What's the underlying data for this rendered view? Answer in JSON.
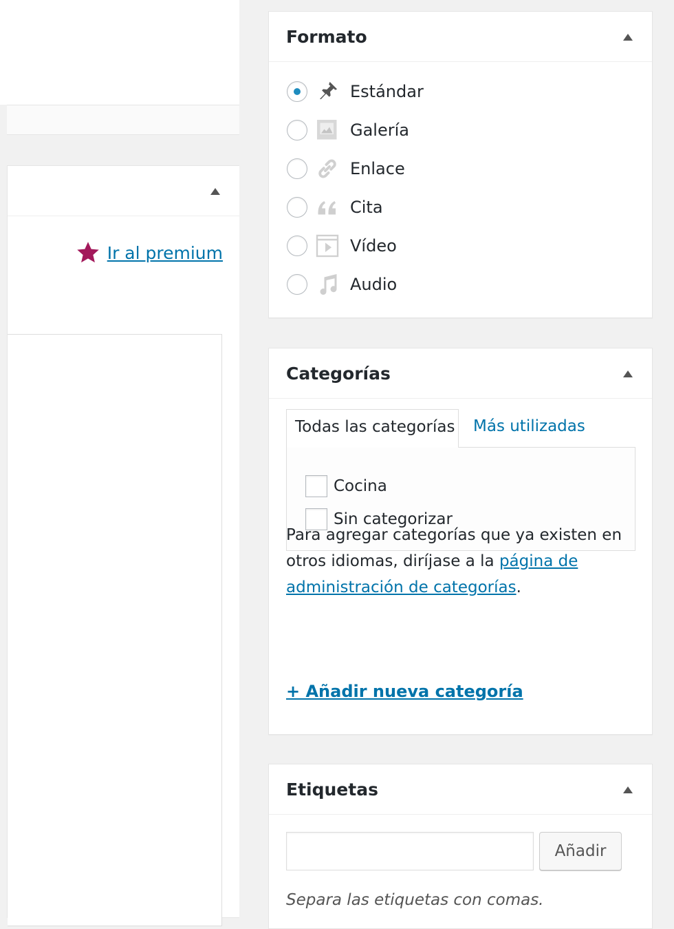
{
  "left": {
    "premium_link": "Ir al premium",
    "star_color": "#a3195b"
  },
  "format": {
    "title": "Formato",
    "options": [
      {
        "label": "Estándar",
        "icon": "pin-icon",
        "checked": true
      },
      {
        "label": "Galería",
        "icon": "gallery-icon",
        "checked": false
      },
      {
        "label": "Enlace",
        "icon": "link-icon",
        "checked": false
      },
      {
        "label": "Cita",
        "icon": "quote-icon",
        "checked": false
      },
      {
        "label": "Vídeo",
        "icon": "video-icon",
        "checked": false
      },
      {
        "label": "Audio",
        "icon": "audio-icon",
        "checked": false
      }
    ]
  },
  "categories": {
    "title": "Categorías",
    "tab_all": "Todas las categorías",
    "tab_most_used": "Más utilizadas",
    "items": [
      {
        "label": "Cocina",
        "checked": false
      },
      {
        "label": "Sin categorizar",
        "checked": false
      }
    ],
    "note_prefix": "Para agregar categorías que ya existen en otros idiomas, diríjase a la ",
    "note_link": "página de administración de categorías",
    "note_suffix": ".",
    "add_new": "+ Añadir nueva categoría"
  },
  "tags": {
    "title": "Etiquetas",
    "input_value": "",
    "add_button": "Añadir",
    "hint": "Separa las etiquetas con comas."
  },
  "colors": {
    "link": "#0073aa",
    "radio_checked": "#1e8cbe",
    "background": "#f1f1f1"
  }
}
